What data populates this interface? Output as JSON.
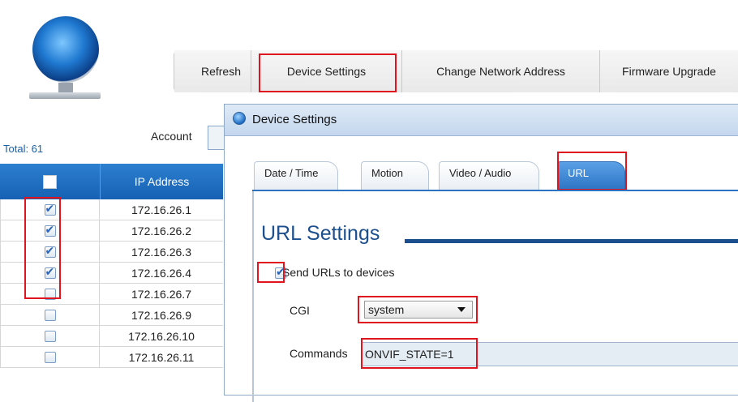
{
  "toolbar": {
    "refresh_label": "Refresh",
    "device_settings_label": "Device Settings",
    "change_network_label": "Change Network Address",
    "firmware_upgrade_label": "Firmware Upgrade"
  },
  "left_panel": {
    "total_label": "Total: 61",
    "account_label": "Account",
    "grid": {
      "header_ip": "IP Address",
      "rows": [
        {
          "ip": "172.16.26.1",
          "checked": true
        },
        {
          "ip": "172.16.26.2",
          "checked": true
        },
        {
          "ip": "172.16.26.3",
          "checked": true
        },
        {
          "ip": "172.16.26.4",
          "checked": true
        },
        {
          "ip": "172.16.26.7",
          "checked": false
        },
        {
          "ip": "172.16.26.9",
          "checked": false
        },
        {
          "ip": "172.16.26.10",
          "checked": false
        },
        {
          "ip": "172.16.26.11",
          "checked": false
        }
      ]
    }
  },
  "dialog": {
    "title": "Device Settings",
    "tabs": [
      "Date / Time",
      "Motion",
      "Video / Audio",
      "URL"
    ],
    "active_tab": "URL",
    "section_title": "URL Settings",
    "send_urls_label": "Send URLs to devices",
    "send_urls_checked": true,
    "cgi_label": "CGI",
    "cgi_value": "system",
    "commands_label": "Commands",
    "commands_value": "ONVIF_STATE=1"
  },
  "colors": {
    "accent_blue": "#1661b3",
    "highlight_red": "#e0141e",
    "title_blue": "#1c4f8e"
  }
}
